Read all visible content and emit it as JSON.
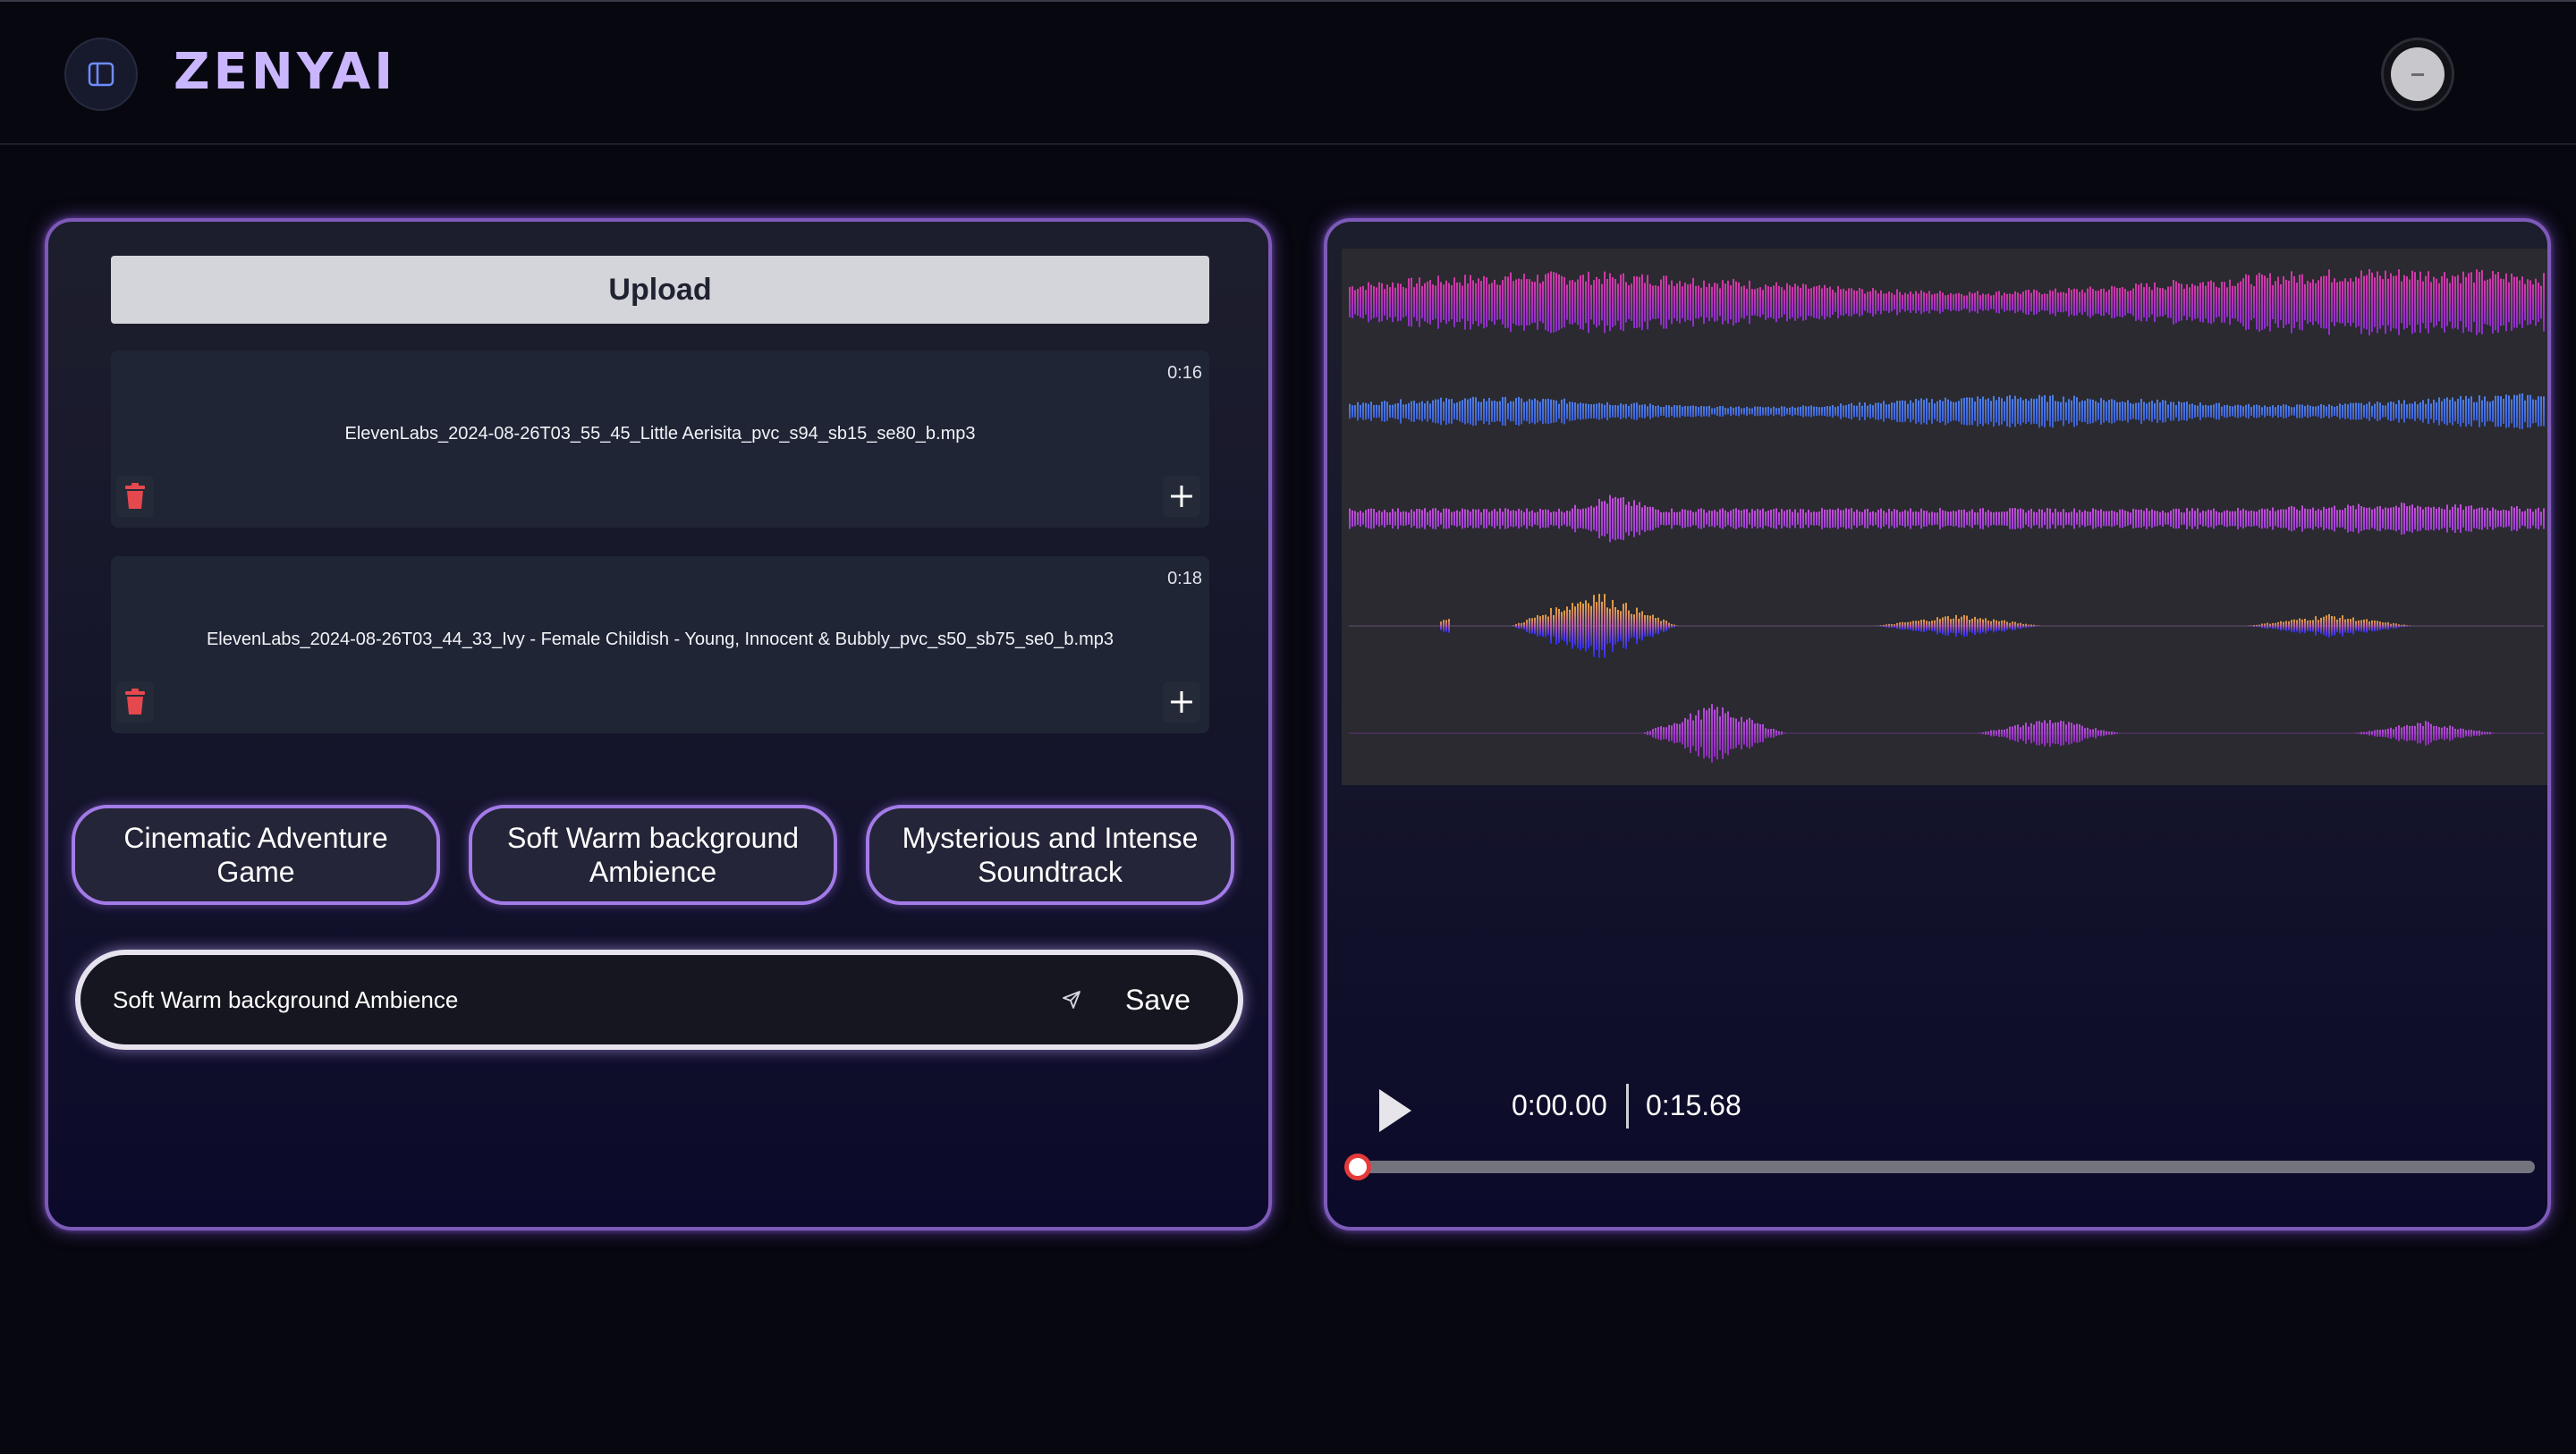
{
  "app": {
    "logo_text": "ZENYAI",
    "sidebar_toggle_icon": "sidebar-panel-icon",
    "avatar_icon": "user-avatar-icon"
  },
  "colors": {
    "background": "#07070f",
    "panel_border": "#7d5ab8",
    "accent_purple": "#a37be8",
    "logo": "#c9b6ff",
    "upload_button": "#d3d5da",
    "delete_icon": "#e5484d",
    "seek_knob": "#e53a3a",
    "wave_pink": "#c43bb8",
    "wave_blue": "#4a6ee0",
    "wave_violet": "#b34fd6",
    "wave_orange": "#e0a040"
  },
  "library": {
    "upload_label": "Upload",
    "files": [
      {
        "name": "ElevenLabs_2024-08-26T03_55_45_Little Aerisita_pvc_s94_sb15_se80_b.mp3",
        "duration": "0:16",
        "delete_icon": "trash-icon",
        "add_icon": "plus-icon"
      },
      {
        "name": "ElevenLabs_2024-08-26T03_44_33_Ivy - Female Childish - Young, Innocent & Bubbly_pvc_s50_sb75_se0_b.mp3",
        "duration": "0:18",
        "delete_icon": "trash-icon",
        "add_icon": "plus-icon"
      }
    ]
  },
  "presets": [
    {
      "label": "Cinematic Adventure Game"
    },
    {
      "label": "Soft Warm background Ambience"
    },
    {
      "label": "Mysterious and Intense Soundtrack"
    }
  ],
  "prompt": {
    "value": "Soft Warm background Ambience",
    "send_icon": "send-icon",
    "save_label": "Save"
  },
  "player": {
    "play_icon": "play-icon",
    "current_time": "0:00.00",
    "total_time": "0:15.68",
    "progress": 0,
    "tracks": [
      {
        "icon": "waveform-track-1",
        "color": "#c43bb8"
      },
      {
        "icon": "waveform-track-2",
        "color": "#4a6ee0"
      },
      {
        "icon": "waveform-track-3",
        "color": "#b34fd6"
      },
      {
        "icon": "waveform-track-4",
        "color": "#e0a040"
      },
      {
        "icon": "waveform-track-5",
        "color": "#b34fd6"
      }
    ]
  }
}
